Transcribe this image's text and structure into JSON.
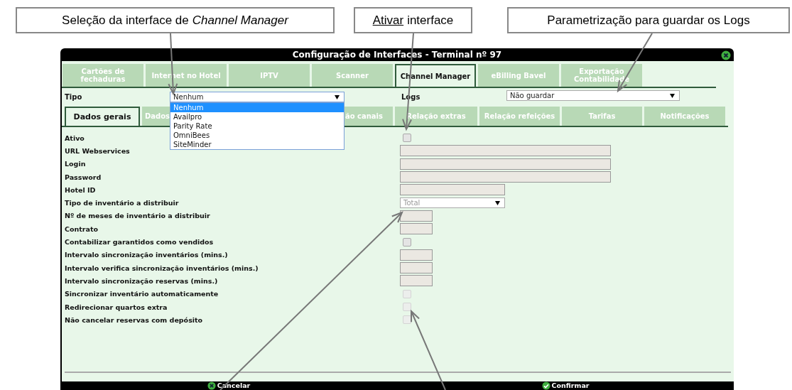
{
  "callouts": [
    {
      "text": "Seleção da interface de *Channel Manager*"
    },
    {
      "underlined_word": "Ativar",
      "text": "interface"
    },
    {
      "text": "Parametrização para guardar os Logs"
    }
  ],
  "window": {
    "title": "Configuração de Interfaces - Terminal nº 97"
  },
  "tabs": [
    {
      "label": "Cartões de fechaduras",
      "selected": false
    },
    {
      "label": "Internet no Hotel",
      "selected": false
    },
    {
      "label": "IPTV",
      "selected": false
    },
    {
      "label": "Scanner",
      "selected": false
    },
    {
      "label": "Channel Manager",
      "selected": true
    },
    {
      "label": "eBilling Bavel",
      "selected": false
    },
    {
      "label": "Exportação Contabilidade",
      "selected": false
    }
  ],
  "tipo": {
    "label": "Tipo",
    "value": "Nenhum",
    "expanded": true,
    "options": [
      {
        "label": "Nenhum",
        "selected": true
      },
      {
        "label": "Availpro",
        "selected": false
      },
      {
        "label": "Parity Rate",
        "selected": false
      },
      {
        "label": "OmniBees",
        "selected": false
      },
      {
        "label": "SiteMinder",
        "selected": false
      }
    ]
  },
  "logs": {
    "label": "Logs",
    "value": "Não guardar"
  },
  "subtabs": [
    {
      "label": "Dados gerais",
      "selected": true
    },
    {
      "label": "Dados",
      "selected": false
    },
    {
      "label": "ão canais",
      "selected": false
    },
    {
      "label": "Relação extras",
      "selected": false
    },
    {
      "label": "Relação refeições",
      "selected": false
    },
    {
      "label": "Tarifas",
      "selected": false
    },
    {
      "label": "Notificações",
      "selected": false
    }
  ],
  "fields": [
    {
      "label": "Ativo",
      "kind": "checkbox",
      "checked": false,
      "disabled": false
    },
    {
      "label": "URL Webservices",
      "kind": "wide"
    },
    {
      "label": "Login",
      "kind": "wide"
    },
    {
      "label": "Password",
      "kind": "wide"
    },
    {
      "label": "Hotel ID",
      "kind": "medium"
    },
    {
      "label": "Tipo de inventário a distribuir",
      "kind": "select",
      "value": "Total"
    },
    {
      "label": "Nº de meses de inventário a distribuir",
      "kind": "small"
    },
    {
      "label": "Contrato",
      "kind": "small"
    },
    {
      "label": "Contabilizar garantidos como vendidos",
      "kind": "checkbox",
      "checked": false,
      "disabled": false
    },
    {
      "label": "Intervalo sincronização inventários (mins.)",
      "kind": "small"
    },
    {
      "label": "Intervalo verifica sincronização inventários (mins.)",
      "kind": "small"
    },
    {
      "label": "Intervalo sincronização reservas (mins.)",
      "kind": "small"
    },
    {
      "label": "Sincronizar inventário automaticamente",
      "kind": "checkbox",
      "checked": false,
      "disabled": true
    },
    {
      "label": "Redirecionar quartos extra",
      "kind": "checkbox",
      "checked": false,
      "disabled": true
    },
    {
      "label": "Não cancelar reservas com depósito",
      "kind": "checkbox",
      "checked": false,
      "disabled": true
    }
  ],
  "buttons": [
    {
      "label": "Cancelar",
      "kind": "cancel"
    },
    {
      "label": "Confirmar",
      "kind": "confirm"
    }
  ]
}
